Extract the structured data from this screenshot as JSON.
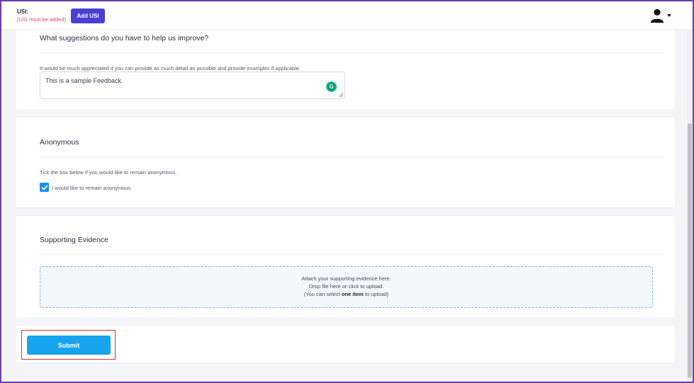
{
  "header": {
    "usi_label": "USI:",
    "usi_warning": "(USI must be added)",
    "add_usi_label": "Add USI",
    "user_icon": "user-icon",
    "caret_icon": "caret-down-icon"
  },
  "feedback": {
    "title": "What suggestions do you have to help us improve?",
    "hint": "It would be much appreciated if you can provide as much detail as possible and provide examples if applicable.",
    "value": "This is a sample Feedback.",
    "grammarly_icon": "grammarly-icon"
  },
  "anonymous": {
    "title": "Anonymous",
    "hint": "Tick the box below if you would like to remain anonymous.",
    "checkbox_label": "I would like to remain anonymous",
    "checked": true
  },
  "evidence": {
    "title": "Supporting Evidence",
    "line1": "Attach your supporting evidence here.",
    "line2": "Drop file here or click to upload.",
    "line3_prefix": "(You can select ",
    "line3_bold": "one item",
    "line3_suffix": " to upload)"
  },
  "actions": {
    "submit_label": "Submit"
  },
  "colors": {
    "primary_button": "#4a3fd1",
    "submit_button": "#17a4ef",
    "warning_text": "#e0457b",
    "checkbox": "#1e90e6",
    "highlight": "#e03131"
  }
}
